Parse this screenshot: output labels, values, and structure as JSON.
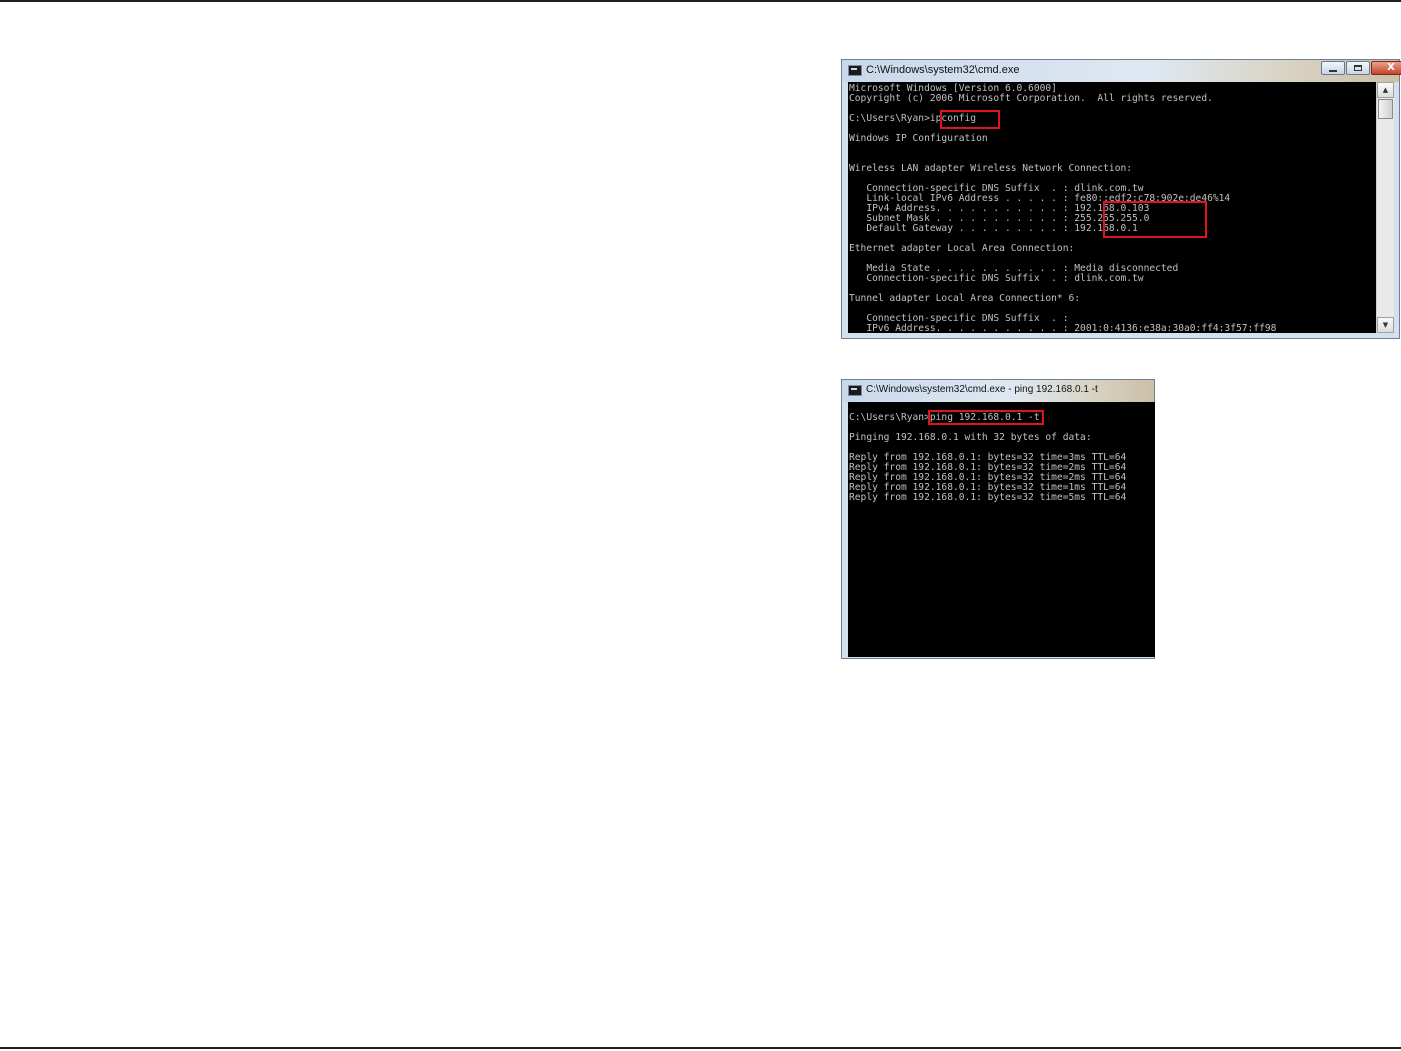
{
  "ipconfig_window": {
    "title": "C:\\Windows\\system32\\cmd.exe",
    "lines": [
      "Microsoft Windows [Version 6.0.6000]",
      "Copyright (c) 2006 Microsoft Corporation.  All rights reserved.",
      "",
      "C:\\Users\\Ryan>ipconfig",
      "",
      "Windows IP Configuration",
      "",
      "",
      "Wireless LAN adapter Wireless Network Connection:",
      "",
      "   Connection-specific DNS Suffix  . : dlink.com.tw",
      "   Link-local IPv6 Address . . . . . : fe80::edf2:c78:902e:de46%14",
      "   IPv4 Address. . . . . . . . . . . : 192.168.0.103",
      "   Subnet Mask . . . . . . . . . . . : 255.255.255.0",
      "   Default Gateway . . . . . . . . . : 192.168.0.1",
      "",
      "Ethernet adapter Local Area Connection:",
      "",
      "   Media State . . . . . . . . . . . : Media disconnected",
      "   Connection-specific DNS Suffix  . : dlink.com.tw",
      "",
      "Tunnel adapter Local Area Connection* 6:",
      "",
      "   Connection-specific DNS Suffix  . :",
      "   IPv6 Address. . . . . . . . . . . : 2001:0:4136:e38a:30a0:ff4:3f57:ff98"
    ],
    "scroll_up_glyph": "▲",
    "scroll_down_glyph": "▼",
    "close_glyph": "X"
  },
  "ping_window": {
    "title": "C:\\Windows\\system32\\cmd.exe - ping  192.168.0.1 -t",
    "lines": [
      "C:\\Users\\Ryan>ping 192.168.0.1 -t",
      "",
      "Pinging 192.168.0.1 with 32 bytes of data:",
      "",
      "Reply from 192.168.0.1: bytes=32 time=3ms TTL=64",
      "Reply from 192.168.0.1: bytes=32 time=2ms TTL=64",
      "Reply from 192.168.0.1: bytes=32 time=2ms TTL=64",
      "Reply from 192.168.0.1: bytes=32 time=1ms TTL=64",
      "Reply from 192.168.0.1: bytes=32 time=5ms TTL=64"
    ]
  },
  "colors": {
    "console_text": "#c0c0c0",
    "console_background": "#000000",
    "highlight_box": "#e0141b",
    "page_rule": "#231f20"
  },
  "icons": {
    "window_icon": "cmd-icon",
    "minimize": "minimize-icon",
    "maximize": "maximize-icon",
    "close": "close-icon"
  }
}
